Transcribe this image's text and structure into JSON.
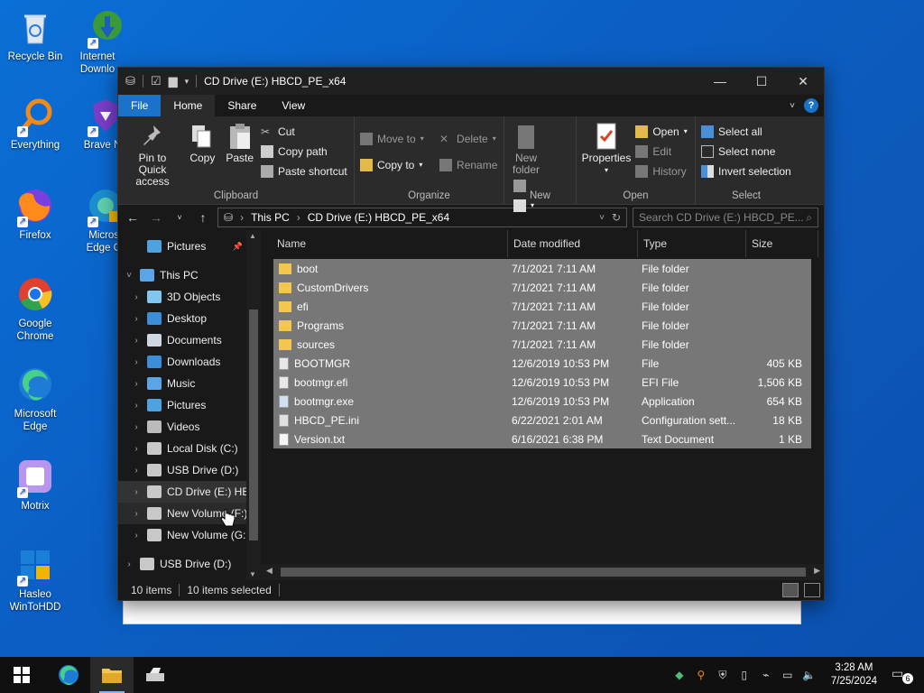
{
  "desktop": {
    "icons": [
      {
        "label": "Recycle Bin",
        "icon": "recycle-bin-icon"
      },
      {
        "label": "Internet Downlo",
        "icon": "internet-download-manager-icon"
      },
      {
        "label": "Everything",
        "icon": "everything-search-icon"
      },
      {
        "label": "Brave Nig",
        "icon": "brave-nightly-icon"
      },
      {
        "label": "Firefox",
        "icon": "firefox-icon"
      },
      {
        "label": "Microsc Edge Ca",
        "icon": "edge-canary-icon"
      },
      {
        "label": "Google Chrome",
        "icon": "chrome-icon"
      },
      {
        "label": "Microsoft Edge",
        "icon": "edge-icon"
      },
      {
        "label": "Motrix",
        "icon": "motrix-icon"
      },
      {
        "label": "Hasleo WinToHDD",
        "icon": "wintohdd-icon"
      }
    ]
  },
  "window": {
    "title": "CD Drive (E:) HBCD_PE_x64",
    "controls": {
      "minimize": "—",
      "maximize": "☐",
      "close": "✕"
    }
  },
  "ribbon": {
    "tabs": [
      "File",
      "Home",
      "Share",
      "View"
    ],
    "active_tab": "Home",
    "clipboard": {
      "pin": "Pin to Quick access",
      "copy": "Copy",
      "paste": "Paste",
      "cut": "Cut",
      "copy_path": "Copy path",
      "paste_shortcut": "Paste shortcut",
      "label": "Clipboard"
    },
    "organize": {
      "move_to": "Move to",
      "copy_to": "Copy to",
      "delete": "Delete",
      "rename": "Rename",
      "label": "Organize"
    },
    "new": {
      "new_folder": "New folder",
      "label": "New"
    },
    "open": {
      "properties": "Properties",
      "open": "Open",
      "edit": "Edit",
      "history": "History",
      "label": "Open"
    },
    "select": {
      "select_all": "Select all",
      "select_none": "Select none",
      "invert": "Invert selection",
      "label": "Select"
    }
  },
  "address": {
    "crumbs": [
      "This PC",
      "CD Drive (E:) HBCD_PE_x64"
    ],
    "search_placeholder": "Search CD Drive (E:) HBCD_PE..."
  },
  "navpane": {
    "items": [
      {
        "label": "Pictures",
        "level": 1,
        "chevron": "",
        "pinned": true
      },
      {
        "label": "This PC",
        "level": 0,
        "chevron": "˅"
      },
      {
        "label": "3D Objects",
        "level": 1,
        "chevron": "›"
      },
      {
        "label": "Desktop",
        "level": 1,
        "chevron": "›"
      },
      {
        "label": "Documents",
        "level": 1,
        "chevron": "›"
      },
      {
        "label": "Downloads",
        "level": 1,
        "chevron": "›"
      },
      {
        "label": "Music",
        "level": 1,
        "chevron": "›"
      },
      {
        "label": "Pictures",
        "level": 1,
        "chevron": "›"
      },
      {
        "label": "Videos",
        "level": 1,
        "chevron": "›"
      },
      {
        "label": "Local Disk (C:)",
        "level": 1,
        "chevron": "›"
      },
      {
        "label": "USB Drive (D:)",
        "level": 1,
        "chevron": "›"
      },
      {
        "label": "CD Drive (E:) HB",
        "level": 1,
        "chevron": "›",
        "selected": true
      },
      {
        "label": "New Volume (F:)",
        "level": 1,
        "chevron": "›",
        "hover": true
      },
      {
        "label": "New Volume (G:",
        "level": 1,
        "chevron": "›"
      },
      {
        "label": "USB Drive (D:)",
        "level": 0,
        "chevron": "›"
      }
    ]
  },
  "files": {
    "columns": [
      "Name",
      "Date modified",
      "Type",
      "Size"
    ],
    "rows": [
      {
        "name": "boot",
        "date": "7/1/2021 7:11 AM",
        "type": "File folder",
        "size": "",
        "kind": "folder"
      },
      {
        "name": "CustomDrivers",
        "date": "7/1/2021 7:11 AM",
        "type": "File folder",
        "size": "",
        "kind": "folder"
      },
      {
        "name": "efi",
        "date": "7/1/2021 7:11 AM",
        "type": "File folder",
        "size": "",
        "kind": "folder"
      },
      {
        "name": "Programs",
        "date": "7/1/2021 7:11 AM",
        "type": "File folder",
        "size": "",
        "kind": "folder"
      },
      {
        "name": "sources",
        "date": "7/1/2021 7:11 AM",
        "type": "File folder",
        "size": "",
        "kind": "folder"
      },
      {
        "name": "BOOTMGR",
        "date": "12/6/2019 10:53 PM",
        "type": "File",
        "size": "405 KB",
        "kind": "file"
      },
      {
        "name": "bootmgr.efi",
        "date": "12/6/2019 10:53 PM",
        "type": "EFI File",
        "size": "1,506 KB",
        "kind": "file"
      },
      {
        "name": "bootmgr.exe",
        "date": "12/6/2019 10:53 PM",
        "type": "Application",
        "size": "654 KB",
        "kind": "app"
      },
      {
        "name": "HBCD_PE.ini",
        "date": "6/22/2021 2:01 AM",
        "type": "Configuration sett...",
        "size": "18 KB",
        "kind": "ini"
      },
      {
        "name": "Version.txt",
        "date": "6/16/2021 6:38 PM",
        "type": "Text Document",
        "size": "1 KB",
        "kind": "txt"
      }
    ]
  },
  "status": {
    "count": "10 items",
    "selected": "10 items selected"
  },
  "taskbar": {
    "time": "3:28 AM",
    "date": "7/25/2024",
    "notifications": "6"
  },
  "colors": {
    "accent": "#1a73c8",
    "folder": "#f3c74d",
    "row_selected": "#777777"
  }
}
